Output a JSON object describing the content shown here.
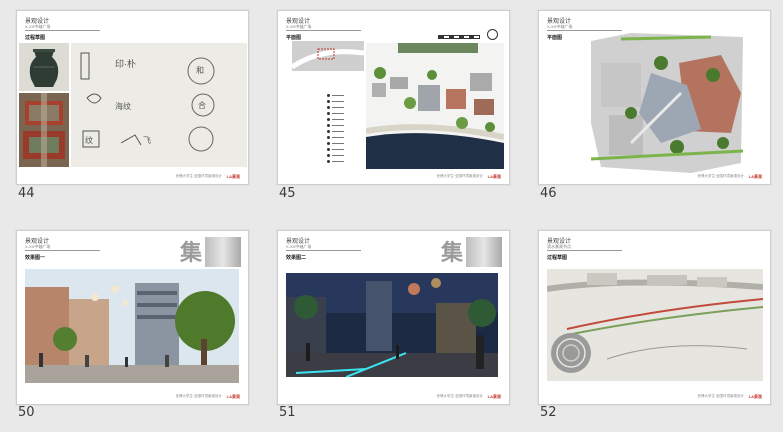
{
  "slides": [
    {
      "number": "44",
      "header_title": "景观设计",
      "header_sub": "X-XX中轴广场",
      "section": "过程草图",
      "footer": "世博大学生·全国环境景观设计",
      "logo": "LA景观"
    },
    {
      "number": "45",
      "header_title": "景观设计",
      "header_sub": "X-XX中轴广场",
      "section": "平面图",
      "footer": "世博大学生·全国环境景观设计",
      "logo": "LA景观"
    },
    {
      "number": "46",
      "header_title": "景观设计",
      "header_sub": "X-XX中轴广场",
      "section": "平面图",
      "footer": "世博大学生·全国环境景观设计",
      "logo": "LA景观"
    },
    {
      "number": "50",
      "header_title": "景观设计",
      "header_sub": "X-XX中轴广场",
      "section": "效果图一",
      "big_char": "集",
      "footer": "世博大学生·全国环境景观设计",
      "logo": "LA景观"
    },
    {
      "number": "51",
      "header_title": "景观设计",
      "header_sub": "X-XX中轴广场",
      "section": "效果图二",
      "big_char": "集",
      "footer": "世博大学生·全国环境景观设计",
      "logo": "LA景观"
    },
    {
      "number": "52",
      "header_title": "景观设计",
      "header_sub": "滨水景观节点",
      "section": "过程草图",
      "footer": "世博大学生·全国环境景观设计",
      "logo": "LA景观"
    }
  ],
  "sketch_labels": [
    "印·朴",
    "和",
    "海纹",
    "合",
    "纹",
    "飞"
  ],
  "colors": {
    "accent_red": "#c0392b",
    "border": "#cfcfcf",
    "background": "#e9e9e9"
  }
}
